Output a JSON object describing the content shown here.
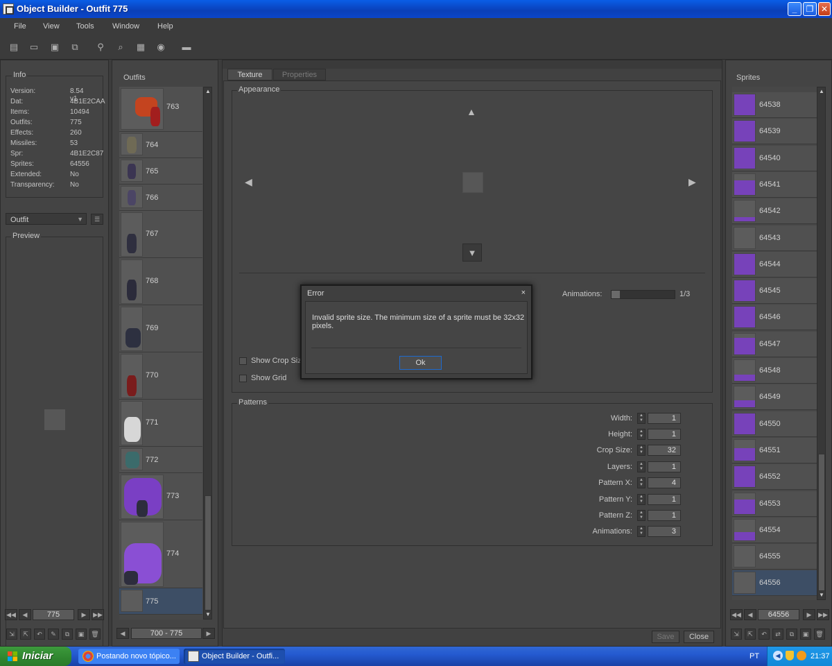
{
  "window": {
    "title": "Object Builder - Outfit 775"
  },
  "menu": [
    "File",
    "View",
    "Tools",
    "Window",
    "Help"
  ],
  "info": {
    "title": "Info",
    "rows": [
      {
        "label": "Version:",
        "value": "8.54 v1"
      },
      {
        "label": "Dat:",
        "value": "4B1E2CAA"
      },
      {
        "label": "Items:",
        "value": "10494"
      },
      {
        "label": "Outfits:",
        "value": "775"
      },
      {
        "label": "Effects:",
        "value": "260"
      },
      {
        "label": "Missiles:",
        "value": "53"
      },
      {
        "label": "Spr:",
        "value": "4B1E2C87"
      },
      {
        "label": "Sprites:",
        "value": "64556"
      },
      {
        "label": "Extended:",
        "value": "No"
      },
      {
        "label": "Transparency:",
        "value": "No"
      }
    ]
  },
  "category_select": "Outfit",
  "preview_title": "Preview",
  "left_nav": {
    "value": "775"
  },
  "outfits": {
    "title": "Outfits",
    "items": [
      "763",
      "764",
      "765",
      "766",
      "767",
      "768",
      "769",
      "770",
      "771",
      "772",
      "773",
      "774",
      "775"
    ],
    "range": "700 - 775"
  },
  "tabs": {
    "texture": "Texture",
    "properties": "Properties"
  },
  "appearance": {
    "title": "Appearance",
    "animations_label": "Animations:",
    "animations_value": "1/3",
    "show_crop_size": "Show Crop Size",
    "show_grid": "Show Grid"
  },
  "patterns": {
    "title": "Patterns",
    "fields": [
      {
        "label": "Width:",
        "value": "1"
      },
      {
        "label": "Height:",
        "value": "1"
      },
      {
        "label": "Crop Size:",
        "value": "32"
      },
      {
        "label": "Layers:",
        "value": "1"
      },
      {
        "label": "Pattern X:",
        "value": "4"
      },
      {
        "label": "Pattern Y:",
        "value": "1"
      },
      {
        "label": "Pattern Z:",
        "value": "1"
      },
      {
        "label": "Animations:",
        "value": "3"
      }
    ]
  },
  "bottom_buttons": {
    "save": "Save",
    "close": "Close"
  },
  "dialog": {
    "title": "Error",
    "close": "×",
    "message": "Invalid sprite size. The minimum size of a sprite must be 32x32 pixels.",
    "ok": "Ok"
  },
  "sprites": {
    "title": "Sprites",
    "items": [
      "64538",
      "64539",
      "64540",
      "64541",
      "64542",
      "64543",
      "64544",
      "64545",
      "64546",
      "64547",
      "64548",
      "64549",
      "64550",
      "64551",
      "64552",
      "64553",
      "64554",
      "64555",
      "64556"
    ],
    "nav_value": "64556"
  },
  "taskbar": {
    "start": "Iniciar",
    "tasks": [
      "Postando novo tópico...",
      "Object Builder - Outfi..."
    ],
    "lang": "PT",
    "time": "21:37"
  },
  "colors": {
    "accent_selected": "#3d4e65",
    "sprite_purple": "#7a3fc4",
    "title_blue": "#0a5ee6"
  }
}
